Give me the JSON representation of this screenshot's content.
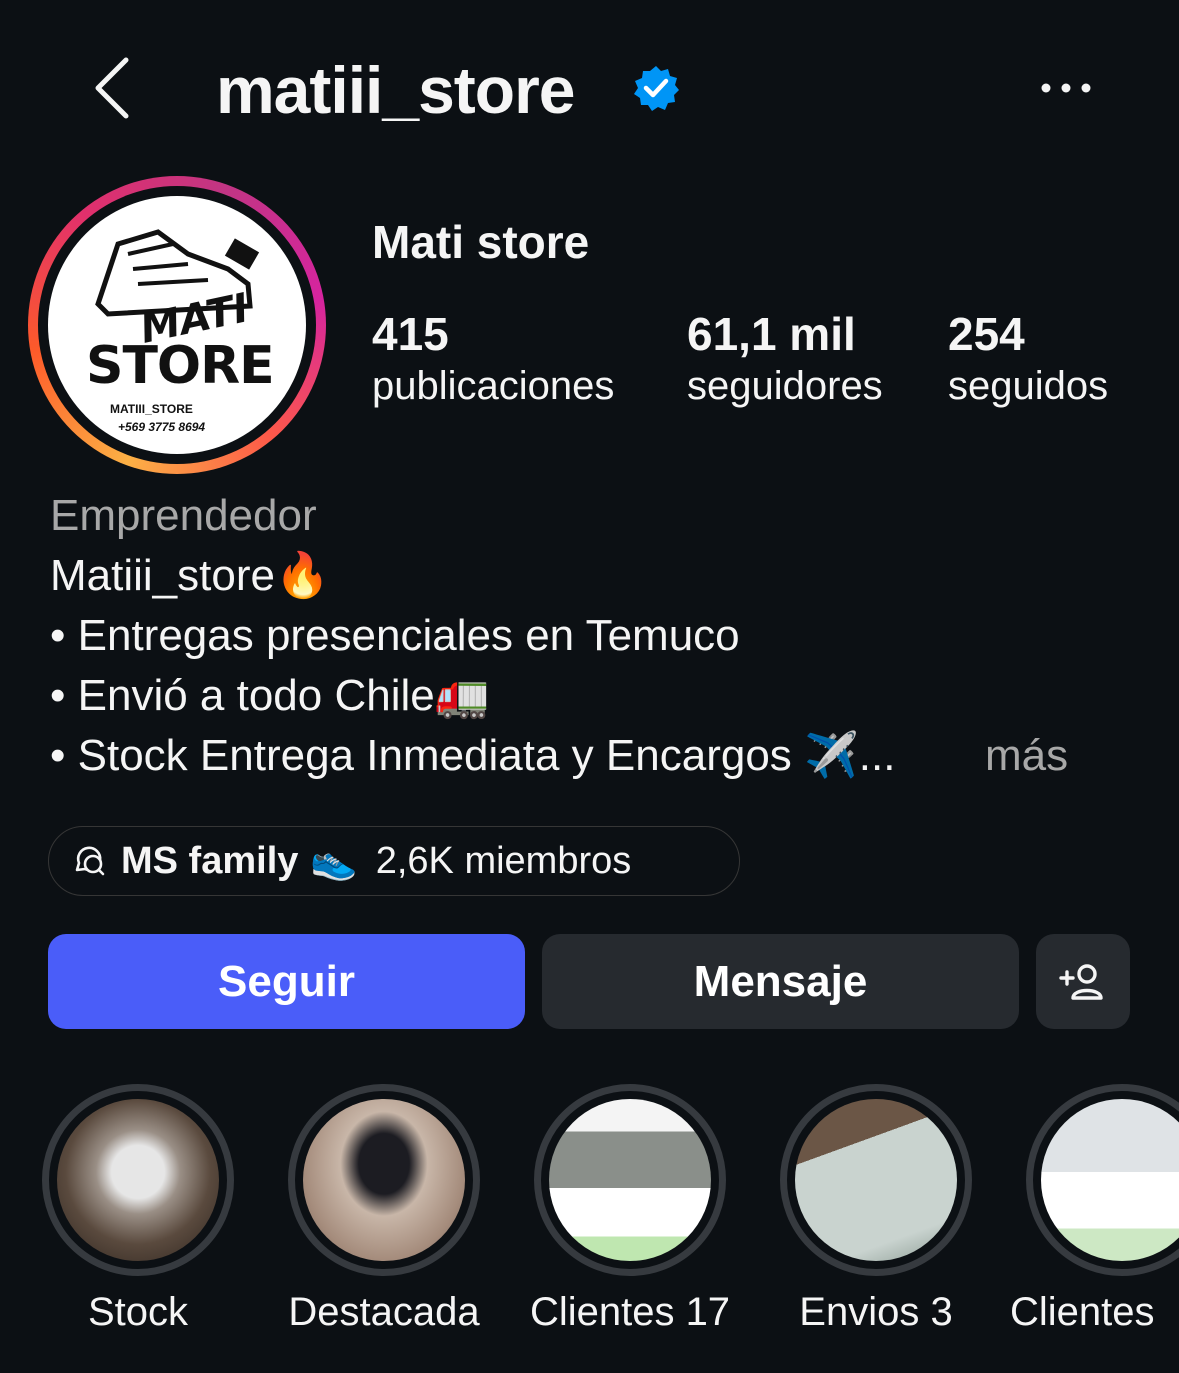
{
  "header": {
    "username": "matiii_store",
    "verified": true,
    "back_icon": "chevron-left-icon",
    "more_icon": "more-horizontal-icon"
  },
  "profile": {
    "full_name": "Mati store",
    "avatar_text": {
      "line1": "MATI",
      "line2": "STORE",
      "handle": "MATIII_STORE",
      "phone": "+569 3775 8694"
    },
    "stats": [
      {
        "value": "415",
        "label": "publicaciones"
      },
      {
        "value": "61,1 mil",
        "label": "seguidores"
      },
      {
        "value": "254",
        "label": "seguidos"
      }
    ]
  },
  "bio": {
    "category": "Emprendedor",
    "lines": [
      "Matiii_store🔥",
      "• Entregas presenciales en Temuco",
      "• Envió a todo Chile🚛",
      "• Stock Entrega Inmediata y Encargos ✈️..."
    ],
    "more_label": "más"
  },
  "channel": {
    "icon": "broadcast-channel-icon",
    "name": "MS family",
    "emoji": "👟",
    "members": "2,6K miembros"
  },
  "actions": {
    "follow_label": "Seguir",
    "message_label": "Mensaje",
    "add_user_icon": "add-user-icon"
  },
  "colors": {
    "background": "#0c1014",
    "follow_button": "#4a5df9",
    "secondary_button": "#262a2f",
    "verified_badge": "#0095f6",
    "muted_text": "#a8a8a8"
  },
  "highlights": [
    {
      "label": "Stock"
    },
    {
      "label": "Destacada"
    },
    {
      "label": "Clientes 17"
    },
    {
      "label": "Envios 3"
    },
    {
      "label": "Clientes"
    }
  ]
}
